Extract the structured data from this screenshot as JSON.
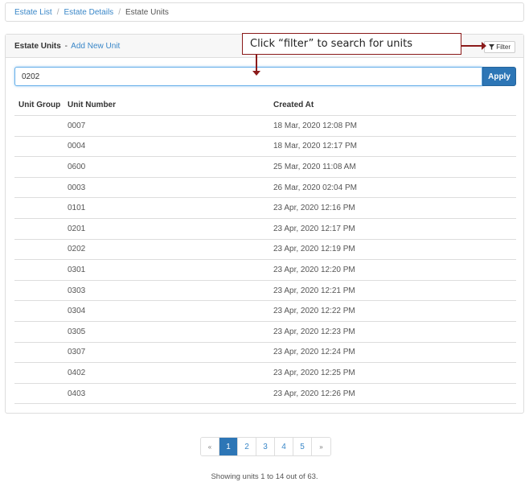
{
  "breadcrumb": {
    "items": [
      {
        "label": "Estate List"
      },
      {
        "label": "Estate Details"
      },
      {
        "label": "Estate Units"
      }
    ],
    "separator": "/"
  },
  "panel": {
    "title": "Estate Units",
    "dash": "-",
    "add_link": "Add New Unit",
    "filter_label": "Filter"
  },
  "callout": {
    "text": "Click “filter” to search for units",
    "color": "#8b1a1a"
  },
  "search": {
    "value": "0202",
    "apply_label": "Apply"
  },
  "table": {
    "headers": {
      "group": "Unit Group",
      "number": "Unit Number",
      "created": "Created At"
    },
    "rows": [
      {
        "group": "",
        "number": "0007",
        "created": "18 Mar, 2020 12:08 PM"
      },
      {
        "group": "",
        "number": "0004",
        "created": "18 Mar, 2020 12:17 PM"
      },
      {
        "group": "",
        "number": "0600",
        "created": "25 Mar, 2020 11:08 AM"
      },
      {
        "group": "",
        "number": "0003",
        "created": "26 Mar, 2020 02:04 PM"
      },
      {
        "group": "",
        "number": "0101",
        "created": "23 Apr, 2020 12:16 PM"
      },
      {
        "group": "",
        "number": "0201",
        "created": "23 Apr, 2020 12:17 PM"
      },
      {
        "group": "",
        "number": "0202",
        "created": "23 Apr, 2020 12:19 PM"
      },
      {
        "group": "",
        "number": "0301",
        "created": "23 Apr, 2020 12:20 PM"
      },
      {
        "group": "",
        "number": "0303",
        "created": "23 Apr, 2020 12:21 PM"
      },
      {
        "group": "",
        "number": "0304",
        "created": "23 Apr, 2020 12:22 PM"
      },
      {
        "group": "",
        "number": "0305",
        "created": "23 Apr, 2020 12:23 PM"
      },
      {
        "group": "",
        "number": "0307",
        "created": "23 Apr, 2020 12:24 PM"
      },
      {
        "group": "",
        "number": "0402",
        "created": "23 Apr, 2020 12:25 PM"
      },
      {
        "group": "",
        "number": "0403",
        "created": "23 Apr, 2020 12:26 PM"
      }
    ]
  },
  "pagination": {
    "prev": "«",
    "pages": [
      "1",
      "2",
      "3",
      "4",
      "5"
    ],
    "next": "»",
    "active": "1"
  },
  "footer": {
    "text": "Showing units 1 to 14 out of 63."
  },
  "colors": {
    "accent": "#2d76b6",
    "link": "#3a87c8"
  }
}
